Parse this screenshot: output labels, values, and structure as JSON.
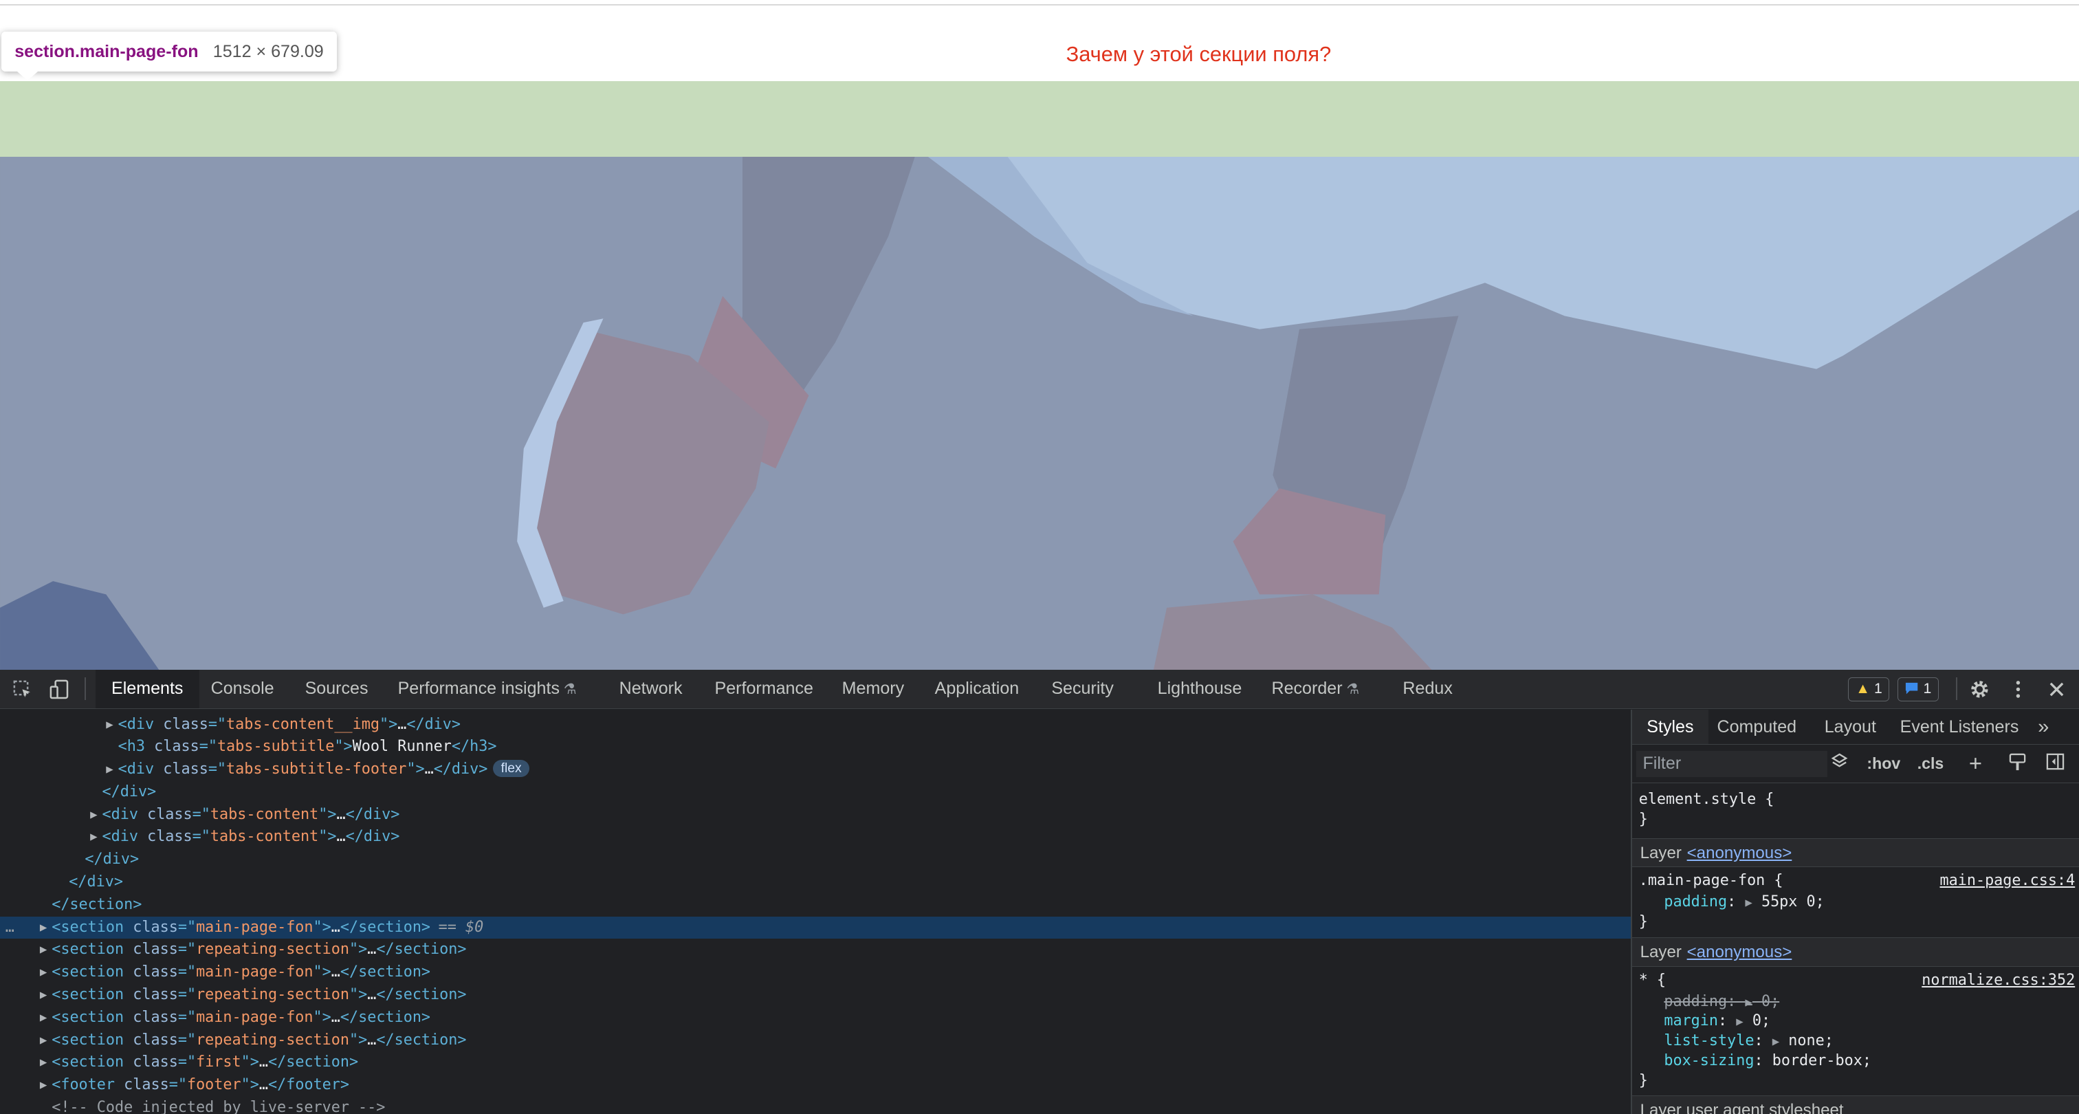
{
  "page": {
    "annotation": "Зачем у этой секции поля?"
  },
  "tooltip": {
    "selector": "section.main-page-fon",
    "size": "1512 × 679.09"
  },
  "devtools": {
    "tabs": [
      "Elements",
      "Console",
      "Sources",
      "Performance insights",
      "Network",
      "Performance",
      "Memory",
      "Application",
      "Security",
      "Lighthouse",
      "Recorder",
      "Redux"
    ],
    "experimental_icon": "⚗",
    "warning_count": "1",
    "message_count": "1",
    "icons": {
      "inspect": "select-element-icon",
      "device": "device-toolbar-icon",
      "settings": "gear-icon",
      "more": "kebab-menu-icon",
      "close": "close-icon"
    }
  },
  "dom_tree": {
    "ellipsis": "…",
    "selected_marker": "== $0",
    "row_dots": "…",
    "rows": [
      {
        "tag": "div",
        "attr": "class",
        "value": "tabs-content__img",
        "collapsed": "…",
        "close": "</div>"
      },
      {
        "tag": "h3",
        "attr": "class",
        "value": "tabs-subtitle",
        "text": "Wool Runner",
        "close": "</h3>"
      },
      {
        "tag": "div",
        "attr": "class",
        "value": "tabs-subtitle-footer",
        "collapsed": "…",
        "close": "</div>",
        "badge": "flex"
      },
      {
        "closing": "</div>"
      },
      {
        "tag": "div",
        "attr": "class",
        "value": "tabs-content",
        "collapsed": "…",
        "close": "</div>"
      },
      {
        "tag": "div",
        "attr": "class",
        "value": "tabs-content",
        "collapsed": "…",
        "close": "</div>"
      },
      {
        "closing": "</div>"
      },
      {
        "closing": "</div>"
      },
      {
        "closing": "</section>"
      },
      {
        "tag": "section",
        "attr": "class",
        "value": "main-page-fon",
        "collapsed": "…",
        "close": "</section>"
      },
      {
        "tag": "section",
        "attr": "class",
        "value": "repeating-section",
        "collapsed": "…",
        "close": "</section>"
      },
      {
        "tag": "section",
        "attr": "class",
        "value": "main-page-fon",
        "collapsed": "…",
        "close": "</section>"
      },
      {
        "tag": "section",
        "attr": "class",
        "value": "repeating-section",
        "collapsed": "…",
        "close": "</section>"
      },
      {
        "tag": "section",
        "attr": "class",
        "value": "main-page-fon",
        "collapsed": "…",
        "close": "</section>"
      },
      {
        "tag": "section",
        "attr": "class",
        "value": "repeating-section",
        "collapsed": "…",
        "close": "</section>"
      },
      {
        "tag": "section",
        "attr": "class",
        "value": "first",
        "collapsed": "…",
        "close": "</section>"
      },
      {
        "tag": "footer",
        "attr": "class",
        "value": "footer",
        "collapsed": "…",
        "close": "</footer>"
      },
      {
        "comment": "<!-- Code injected by live-server -->"
      }
    ]
  },
  "styles": {
    "tabs": [
      "Styles",
      "Computed",
      "Layout",
      "Event Listeners"
    ],
    "more_tabs": "»",
    "filter_placeholder": "Filter",
    "toolbar": {
      "hov": ":hov",
      "cls": ".cls",
      "plus": "+"
    },
    "element_style": {
      "open": "element.style {",
      "close": "}"
    },
    "layer_label": "Layer",
    "layer_name": "<anonymous>",
    "rule1": {
      "selector": ".main-page-fon {",
      "source": "main-page.css:4",
      "prop": "padding",
      "value": "55px 0;",
      "close": "}"
    },
    "rule2": {
      "selector": "* {",
      "source": "normalize.css:352",
      "props": [
        {
          "name": "padding",
          "value": "0;",
          "overridden": true
        },
        {
          "name": "margin",
          "value": "0;"
        },
        {
          "name": "list-style",
          "value": "none;"
        },
        {
          "name": "box-sizing",
          "value": "border-box;"
        }
      ],
      "close": "}"
    },
    "ua_label": "Layer user agent stylesheet"
  }
}
